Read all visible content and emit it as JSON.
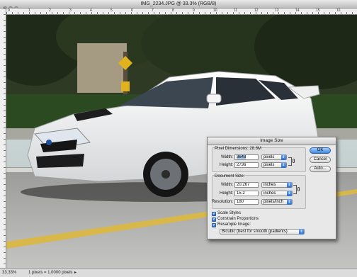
{
  "window": {
    "title": "IMG_2234.JPG @ 33.3% (RGB/8)",
    "ruler_labels": [
      "0",
      "1",
      "2",
      "3",
      "4",
      "5",
      "6",
      "7",
      "8",
      "9",
      "10",
      "11",
      "12",
      "13",
      "14",
      "15",
      "16"
    ]
  },
  "status_bar": {
    "zoom": "33.33%",
    "info": "1 pixels = 1.0000 pixels"
  },
  "dialog": {
    "title": "Image Size",
    "pixel_dimensions": {
      "label": "Pixel Dimensions:",
      "value": "28.6M",
      "width_label": "Width:",
      "width_value": "3648",
      "width_unit": "pixels",
      "height_label": "Height:",
      "height_value": "2736",
      "height_unit": "pixels"
    },
    "document_size": {
      "label": "Document Size:",
      "width_label": "Width:",
      "width_value": "20.267",
      "width_unit": "inches",
      "height_label": "Height:",
      "height_value": "15.2",
      "height_unit": "inches",
      "resolution_label": "Resolution:",
      "resolution_value": "180",
      "resolution_unit": "pixels/inch"
    },
    "options": [
      {
        "label": "Scale Styles",
        "checked": true
      },
      {
        "label": "Constrain Proportions",
        "checked": true
      },
      {
        "label": "Resample Image:",
        "checked": true
      }
    ],
    "resample_method": "Bicubic (best for smooth gradients)",
    "buttons": {
      "ok": "OK",
      "cancel": "Cancel",
      "auto": "Auto..."
    }
  },
  "colors": {
    "accent": "#3b86e0",
    "car_body": "#f2f2f2",
    "road_line": "#d8b84a"
  }
}
